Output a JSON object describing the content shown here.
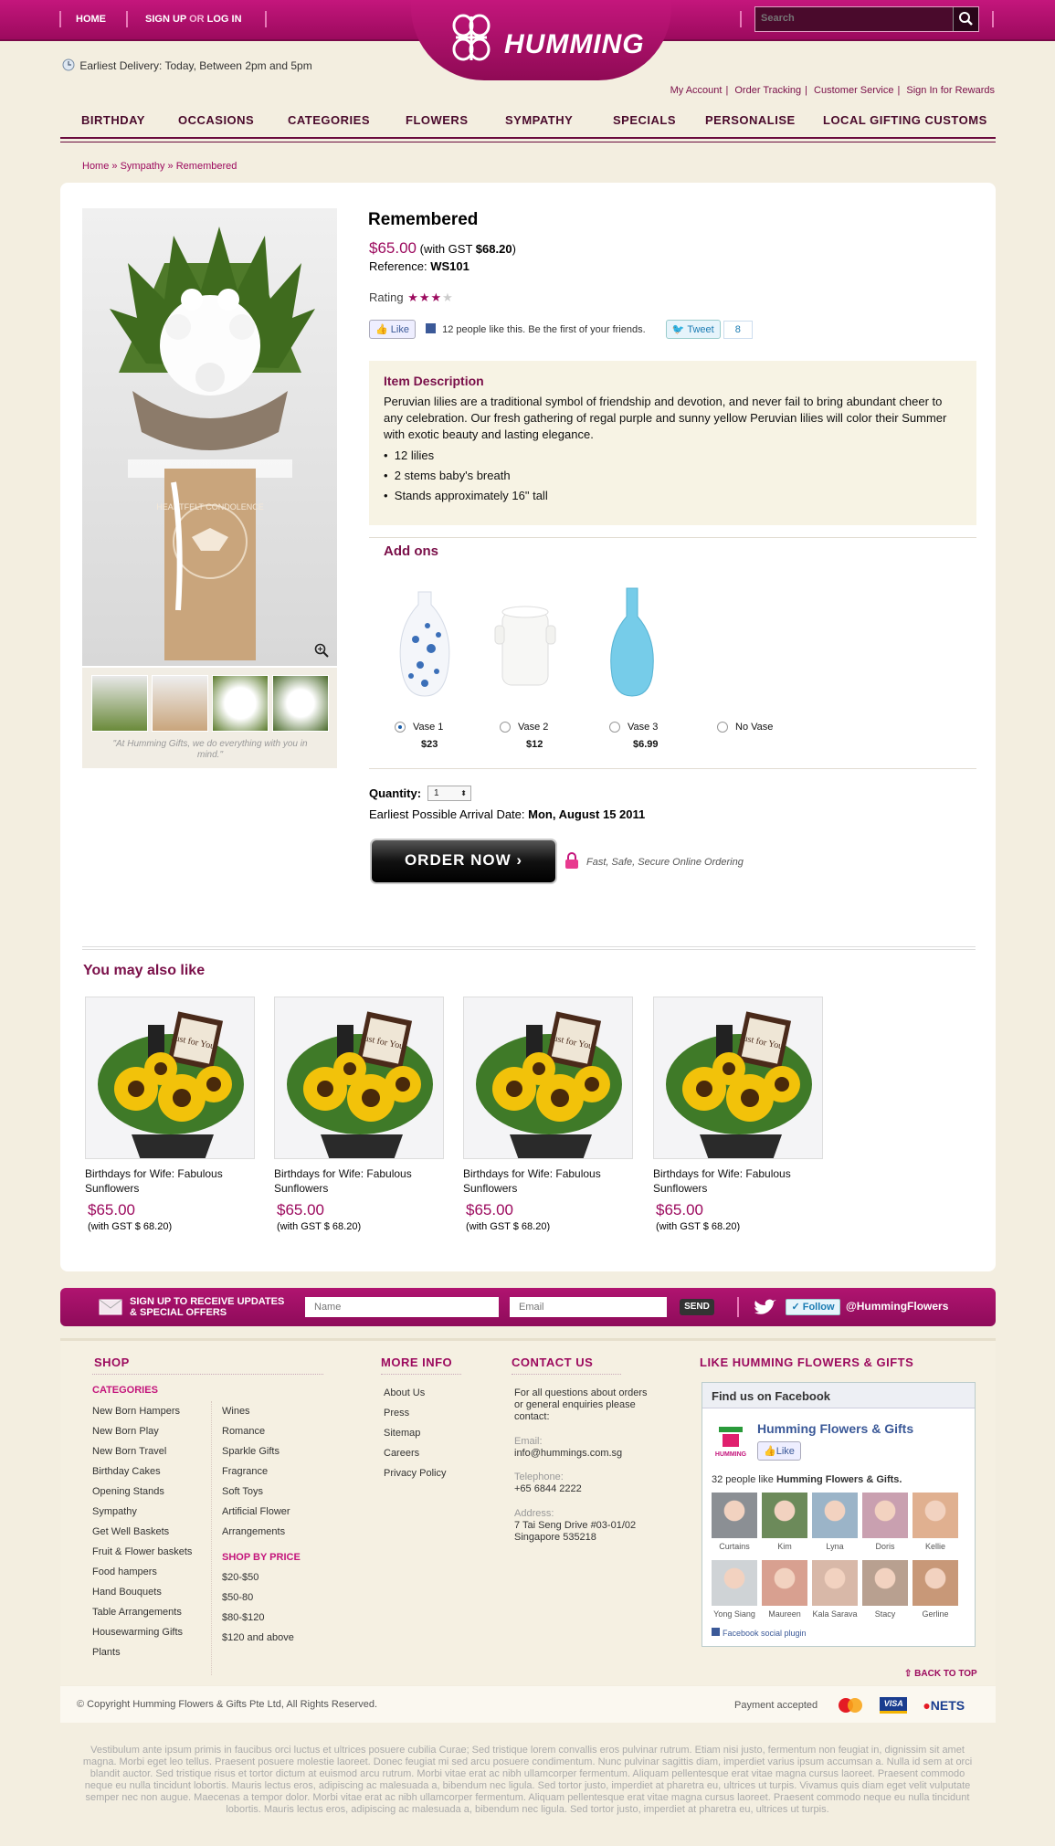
{
  "topbar": {
    "home_label": "HOME",
    "signup_label": "SIGN UP",
    "or_label": "OR",
    "login_label": "LOG IN",
    "brand": "HUMMING",
    "search_placeholder": "Search"
  },
  "delivery_text": "Earliest Delivery: Today, Between 2pm and 5pm",
  "account_links": [
    "My Account",
    "Order Tracking",
    "Customer Service",
    "Sign In for Rewards"
  ],
  "nav": [
    "BIRTHDAY",
    "OCCASIONS",
    "CATEGORIES",
    "FLOWERS",
    "SYMPATHY",
    "SPECIALS",
    "PERSONALISE",
    "LOCAL GIFTING CUSTOMS"
  ],
  "breadcrumb": [
    "Home",
    "Sympathy",
    "Remembered"
  ],
  "product": {
    "title": "Remembered",
    "price": "$65.00",
    "gst_prefix": "(with GST ",
    "gst_price": "$68.20",
    "gst_suffix": ")",
    "reference_label": "Reference:",
    "reference": "WS101",
    "rating_label": "Rating",
    "rating": 3,
    "rating_max": 4,
    "quote": "\"At Humming Gifts, we do everything with you in mind.\"",
    "image_text": "HEARTFELT CONDOLENCE"
  },
  "social": {
    "like_label": "Like",
    "like_text": "12 people like this. Be the first of your friends.",
    "tweet_label": "Tweet",
    "tweet_count": "8"
  },
  "description": {
    "heading": "Item Description",
    "text": "Peruvian lilies are a traditional symbol of friendship and devotion, and never fail to bring abundant cheer to any celebration. Our fresh gathering of regal purple and sunny yellow Peruvian lilies will color their Summer with exotic beauty and lasting elegance.",
    "bullets": [
      "12 lilies",
      "2 stems baby's breath",
      "Stands approximately 16\" tall"
    ]
  },
  "addons": {
    "heading": "Add ons",
    "options": [
      {
        "label": "Vase 1",
        "price": "$23",
        "selected": true
      },
      {
        "label": "Vase 2",
        "price": "$12",
        "selected": false
      },
      {
        "label": "Vase 3",
        "price": "$6.99",
        "selected": false
      },
      {
        "label": "No Vase",
        "price": "",
        "selected": false
      }
    ]
  },
  "order": {
    "quantity_label": "Quantity:",
    "quantity_value": "1",
    "arrival_label": "Earliest Possible Arrival Date:",
    "arrival_date": "Mon, August 15 2011",
    "button_label": "ORDER NOW",
    "secure_text": "Fast, Safe, Secure Online Ordering"
  },
  "ymal": {
    "heading": "You may also like",
    "items": [
      {
        "name": "Birthdays for Wife: Fabulous Sunflowers",
        "price": "$65.00",
        "gst": "(with GST $ 68.20)",
        "card_text": "Just for You"
      },
      {
        "name": "Birthdays for Wife: Fabulous Sunflowers",
        "price": "$65.00",
        "gst": "(with GST $ 68.20)",
        "card_text": "Just for You"
      },
      {
        "name": "Birthdays for Wife: Fabulous Sunflowers",
        "price": "$65.00",
        "gst": "(with GST $ 68.20)",
        "card_text": "Just for You"
      },
      {
        "name": "Birthdays for Wife: Fabulous Sunflowers",
        "price": "$65.00",
        "gst": "(with GST $ 68.20)",
        "card_text": "Just for You"
      }
    ]
  },
  "signup": {
    "text_line1": "SIGN UP TO RECEIVE UPDATES",
    "text_line2": "& SPECIAL OFFERS",
    "name_placeholder": "Name",
    "email_placeholder": "Email",
    "send_label": "SEND",
    "follow_label": "Follow",
    "twitter_handle": "@HummingFlowers"
  },
  "footer": {
    "shop_heading": "SHOP",
    "categories_label": "CATEGORIES",
    "categories_col1": [
      "New Born Hampers",
      "New Born Play",
      "New Born Travel",
      "Birthday Cakes",
      "Opening Stands",
      "Sympathy",
      "Get Well Baskets",
      "Fruit & Flower baskets",
      "Food hampers",
      "Hand Bouquets",
      "Table Arrangements",
      "Housewarming Gifts",
      "Plants"
    ],
    "categories_col2": [
      "Wines",
      "Romance",
      "Sparkle Gifts",
      "Fragrance",
      "Soft Toys",
      "Artificial Flower",
      "Arrangements"
    ],
    "shop_by_price_label": "SHOP BY PRICE",
    "price_ranges": [
      "$20-$50",
      "$50-80",
      "$80-$120",
      "$120 and above"
    ],
    "more_info_heading": "MORE INFO",
    "more_info": [
      "About Us",
      "Press",
      "Sitemap",
      "Careers",
      "Privacy Policy"
    ],
    "contact_heading": "CONTACT US",
    "contact_intro": "For all questions about orders or general enquiries please contact:",
    "email_label": "Email:",
    "email": "info@hummings.com.sg",
    "phone_label": "Telephone:",
    "phone": "+65 6844 2222",
    "address_label": "Address:",
    "address_line1": "7 Tai Seng Drive #03-01/02",
    "address_line2": "Singapore 535218",
    "like_heading": "LIKE HUMMING FLOWERS & GIFTS",
    "back_to_top": "BACK TO TOP",
    "copyright": "© Copyright Humming Flowers & Gifts Pte Ltd, All Rights Reserved.",
    "payment_label": "Payment accepted",
    "payment_methods": [
      "MasterCard",
      "VISA",
      "eNETS"
    ]
  },
  "facebook": {
    "header": "Find us on Facebook",
    "page_name": "Humming Flowers & Gifts",
    "like_label": "Like",
    "count_text": "32 people like",
    "count_name": "Humming Flowers & Gifts.",
    "fans": [
      "Curtains",
      "Kim",
      "Lyna",
      "Doris",
      "Kellie",
      "Yong Siang",
      "Maureen",
      "Kala Sarava",
      "Stacy",
      "Gerline"
    ],
    "plugin_label": "Facebook social plugin"
  },
  "lorem": "Vestibulum ante ipsum primis in faucibus orci luctus et ultrices posuere cubilia Curae; Sed tristique lorem convallis eros pulvinar rutrum. Etiam nisi justo, fermentum non feugiat in, dignissim sit amet magna. Morbi eget leo tellus. Praesent posuere molestie laoreet. Donec feugiat mi sed arcu posuere condimentum. Nunc pulvinar sagittis diam, imperdiet varius ipsum accumsan a. Nulla id sem at orci blandit auctor. Sed tristique risus et tortor dictum at euismod arcu rutrum. Morbi vitae erat ac nibh ullamcorper fermentum. Aliquam pellentesque erat vitae magna cursus laoreet. Praesent commodo neque eu nulla tincidunt lobortis. Mauris lectus eros, adipiscing ac malesuada a, bibendum nec ligula. Sed tortor justo, imperdiet at pharetra eu, ultrices ut turpis. Vivamus quis diam eget velit vulputate semper nec non augue. Maecenas a tempor dolor. Morbi vitae erat ac nibh ullamcorper fermentum. Aliquam pellentesque erat vitae magna cursus laoreet. Praesent commodo neque eu nulla tincidunt lobortis. Mauris lectus eros, adipiscing ac malesuada a, bibendum nec ligula. Sed tortor justo, imperdiet at pharetra eu, ultrices ut turpis.",
  "colors": {
    "brand": "#9c0a5e",
    "brand_light": "#c4167c",
    "background": "#f3eee0",
    "desc_bg": "#f7f3e4"
  },
  "icons": [
    "clock-icon",
    "search-icon",
    "logo-icon",
    "zoom-icon",
    "lock-icon",
    "mail-icon",
    "twitter-bird-icon",
    "facebook-icon",
    "arrow-up-icon"
  ]
}
